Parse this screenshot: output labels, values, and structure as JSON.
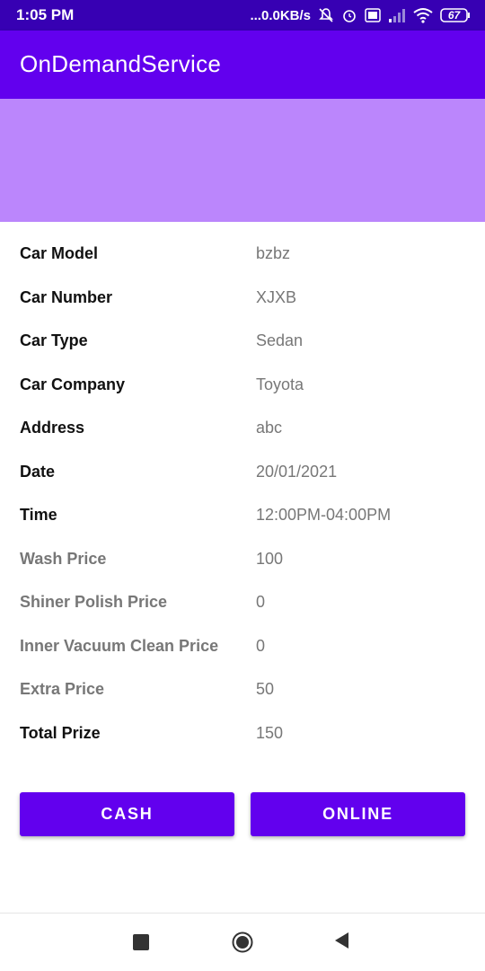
{
  "status_bar": {
    "time": "1:05 PM",
    "network_speed": "...0.0KB/s",
    "battery_level": "67",
    "icons": [
      "mute-icon",
      "alarm-icon",
      "volte-icon",
      "signal-icon",
      "wifi-icon",
      "battery-icon"
    ]
  },
  "app_bar": {
    "title": "OnDemandService"
  },
  "details": [
    {
      "label": "Car Model",
      "value": "bzbz",
      "muted": false
    },
    {
      "label": "Car Number",
      "value": "XJXB",
      "muted": false
    },
    {
      "label": "Car Type",
      "value": "Sedan",
      "muted": false
    },
    {
      "label": "Car Company",
      "value": "Toyota",
      "muted": false
    },
    {
      "label": "Address",
      "value": "abc",
      "muted": false
    },
    {
      "label": "Date",
      "value": "20/01/2021",
      "muted": false
    },
    {
      "label": "Time",
      "value": "12:00PM-04:00PM",
      "muted": false
    },
    {
      "label": "Wash Price",
      "value": "100",
      "muted": true
    },
    {
      "label": "Shiner Polish Price",
      "value": "0",
      "muted": true
    },
    {
      "label": "Inner Vacuum Clean Price",
      "value": "0",
      "muted": true
    },
    {
      "label": "Extra Price",
      "value": "50",
      "muted": true
    },
    {
      "label": "Total Prize",
      "value": "150",
      "muted": false
    }
  ],
  "buttons": {
    "cash": "CASH",
    "online": "ONLINE"
  },
  "nav_bar": {
    "icons": [
      "recents-icon",
      "home-icon",
      "back-icon"
    ]
  },
  "colors": {
    "status_bar": "#3700b3",
    "primary": "#6200ee",
    "banner": "#bb86fc"
  }
}
